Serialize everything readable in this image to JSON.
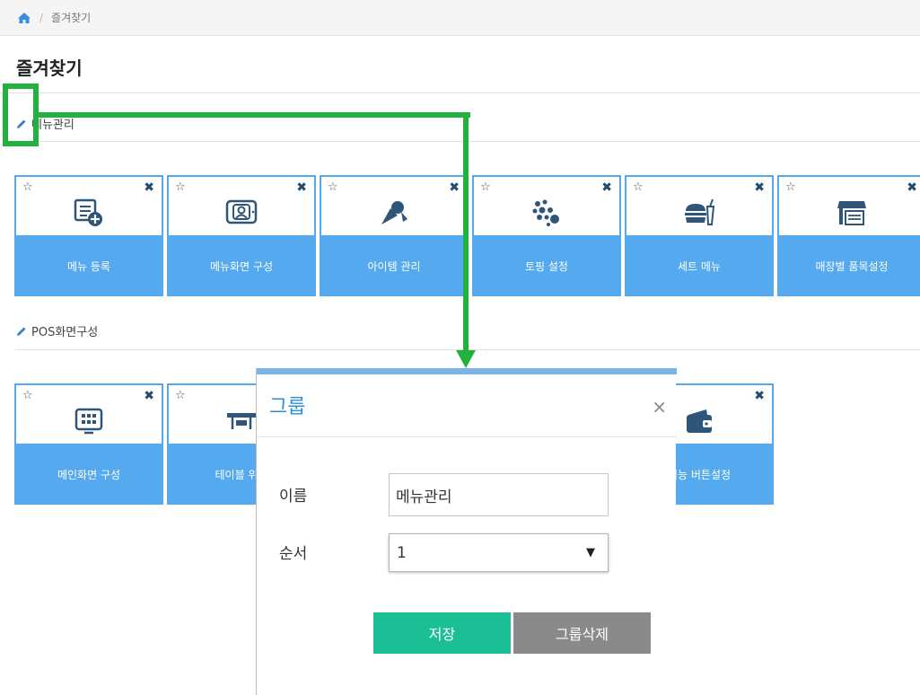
{
  "breadcrumb": {
    "home_icon": "home-icon",
    "separator": "/",
    "current": "즐겨찾기"
  },
  "page_title": "즐겨찾기",
  "groups": [
    {
      "name": "메뉴관리",
      "tiles": [
        {
          "label": "메뉴 등록",
          "icon": "menu-register-icon"
        },
        {
          "label": "메뉴화면 구성",
          "icon": "menu-screen-icon"
        },
        {
          "label": "아이템 관리",
          "icon": "item-icon"
        },
        {
          "label": "토핑 설정",
          "icon": "topping-icon"
        },
        {
          "label": "세트 메뉴",
          "icon": "set-menu-icon"
        },
        {
          "label": "매장별 품목설정",
          "icon": "store-item-icon"
        }
      ]
    },
    {
      "name": "POS화면구성",
      "tiles": [
        {
          "label": "메인화면 구성",
          "icon": "main-screen-icon"
        },
        {
          "label": "테이블 위치",
          "icon": "table-layout-icon"
        },
        {
          "label": "기능 버튼설정",
          "icon": "wallet-icon"
        }
      ]
    }
  ],
  "tile_controls": {
    "star": "☆",
    "remove": "✖"
  },
  "dialog": {
    "title": "그룹",
    "close": "×",
    "name_label": "이름",
    "name_value": "메뉴관리",
    "order_label": "순서",
    "order_value": "1",
    "order_arrow": "▼",
    "save_button": "저장",
    "delete_button": "그룹삭제"
  },
  "colors": {
    "tile_blue": "#55a9ee",
    "annotation_green": "#20b23c",
    "save_green": "#1cbf95",
    "delete_gray": "#8a8a8a",
    "dialog_title": "#2e8fd8"
  }
}
